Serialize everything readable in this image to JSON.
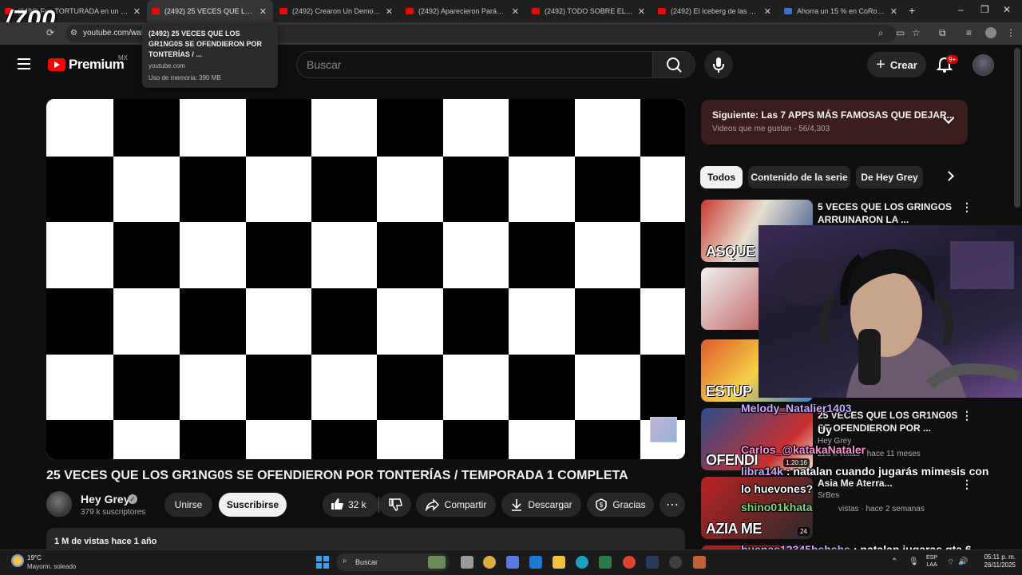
{
  "overlay_counter": "/700",
  "browser": {
    "tabs": [
      {
        "title": "(2492) Fue TORTURADA en un S..."
      },
      {
        "title": "(2492) 25 VECES QUE LOS GR1NG0S..."
      },
      {
        "title": "(2492) Crearon Un Demonio Sa..."
      },
      {
        "title": "(2492) Aparecieron Parásitos G..."
      },
      {
        "title": "(2492) TODO SOBRE EL CASO ..."
      },
      {
        "title": "(2492) El Iceberg de las Grabac..."
      },
      {
        "title": "Ahorra un 15 % en CoRoT en S..."
      }
    ],
    "url": "youtube.com/wat",
    "tooltip": {
      "title": "(2492) 25 VECES QUE LOS GR1NG0S SE OFENDIERON POR TONTERÍAS / ...",
      "domain": "youtube.com",
      "memory": "Uso de memoria: 390 MB"
    }
  },
  "header": {
    "logo_text": "Premium",
    "region": "MX",
    "search_placeholder": "Buscar",
    "create_label": "Crear",
    "notif_badge": "9+"
  },
  "video": {
    "title": "25 VECES QUE LOS GR1NG0S SE OFENDIERON POR TONTERÍAS / TEMPORADA 1 COMPLETA",
    "channel": "Hey Grey",
    "subscribers": "379 k suscriptores",
    "join_label": "Unirse",
    "subscribe_label": "Suscribirse",
    "likes": "32 k",
    "share_label": "Compartir",
    "download_label": "Descargar",
    "thanks_label": "Gracias",
    "views_line": "1 M de vistas  hace 1 año"
  },
  "sidebar": {
    "next_title": "Siguiente: Las 7 APPS MÁS FAMOSAS QUE DEJAR...",
    "next_sub": "Videos que me gustan - 56/4,303",
    "chips": [
      "Todos",
      "Contenido de la serie",
      "De Hey Grey"
    ],
    "recs": [
      {
        "title": "5 VECES QUE LOS GRINGOS ARRUINARON LA ...",
        "thumb_text": "ASQUE"
      },
      {
        "title": "",
        "thumb_text": ""
      },
      {
        "title": "",
        "thumb_text": "ESTUP"
      },
      {
        "title": "25 VECES QUE LOS GR1NG0S SE OFENDIERON POR ...",
        "channel": "Hey Grey",
        "meta": "228 k vistas · hace 11 meses",
        "thumb_text": "OFENDI",
        "duration": "1:20:16"
      },
      {
        "title": "Asia Me Aterra...",
        "channel": "SrBes",
        "meta": "vistas · hace 2 semanas",
        "thumb_text": "AZIA ME",
        "duration": "24"
      },
      {
        "title": "",
        "thumb_text": ""
      }
    ]
  },
  "chat": [
    {
      "user": "Melody_Natalier1403",
      "message": ""
    },
    {
      "user": "",
      "message": "Uy"
    },
    {
      "user": "Carlos_@katakaNataler",
      "message": ""
    },
    {
      "user": "libra14k",
      "message": "natalan cuando jugarás mimesis con lo huevones?"
    },
    {
      "user": "shino01khata",
      "message": ""
    },
    {
      "user": "buenas12345hshshs",
      "message": "natalan jugaras gta 6 cuando salga?"
    }
  ],
  "taskbar": {
    "temp": "19°C",
    "weather": "Mayorm. soleado",
    "search_label": "Buscar",
    "lang_top": "ESP",
    "lang_bottom": "LAA",
    "time": "05:11 p. m.",
    "date": "26/11/2025"
  },
  "colors": {
    "youtube_red": "#ff0000",
    "background": "#0f0f0f",
    "next_card": "#3c1d1d"
  }
}
